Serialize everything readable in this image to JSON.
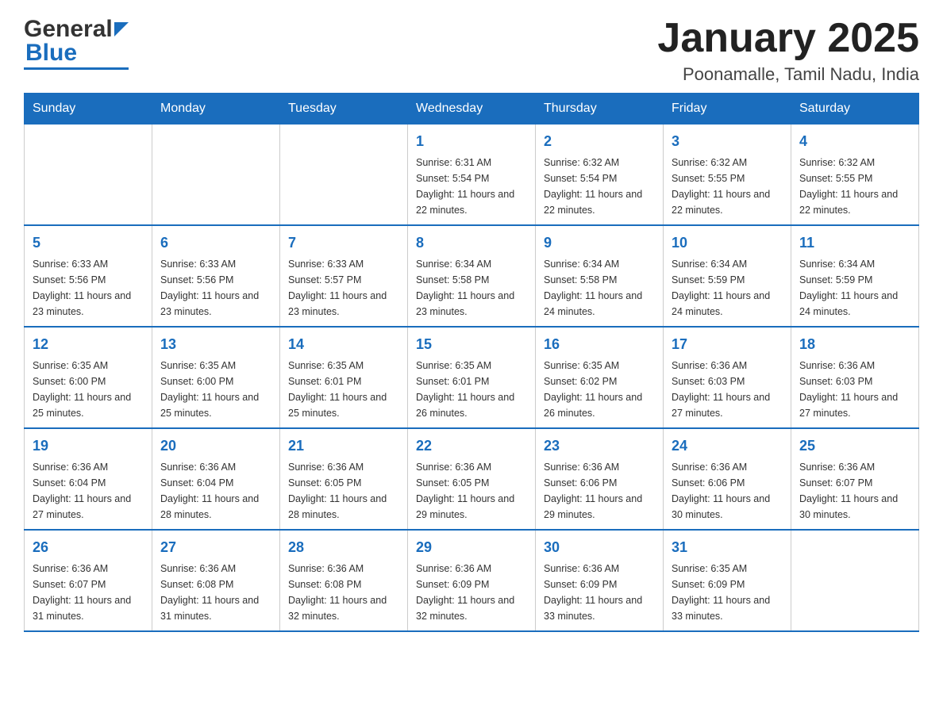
{
  "header": {
    "logo_general": "General",
    "logo_blue": "Blue",
    "title": "January 2025",
    "location": "Poonamalle, Tamil Nadu, India"
  },
  "days_of_week": [
    "Sunday",
    "Monday",
    "Tuesday",
    "Wednesday",
    "Thursday",
    "Friday",
    "Saturday"
  ],
  "weeks": [
    [
      {
        "day": "",
        "info": ""
      },
      {
        "day": "",
        "info": ""
      },
      {
        "day": "",
        "info": ""
      },
      {
        "day": "1",
        "info": "Sunrise: 6:31 AM\nSunset: 5:54 PM\nDaylight: 11 hours\nand 22 minutes."
      },
      {
        "day": "2",
        "info": "Sunrise: 6:32 AM\nSunset: 5:54 PM\nDaylight: 11 hours\nand 22 minutes."
      },
      {
        "day": "3",
        "info": "Sunrise: 6:32 AM\nSunset: 5:55 PM\nDaylight: 11 hours\nand 22 minutes."
      },
      {
        "day": "4",
        "info": "Sunrise: 6:32 AM\nSunset: 5:55 PM\nDaylight: 11 hours\nand 22 minutes."
      }
    ],
    [
      {
        "day": "5",
        "info": "Sunrise: 6:33 AM\nSunset: 5:56 PM\nDaylight: 11 hours\nand 23 minutes."
      },
      {
        "day": "6",
        "info": "Sunrise: 6:33 AM\nSunset: 5:56 PM\nDaylight: 11 hours\nand 23 minutes."
      },
      {
        "day": "7",
        "info": "Sunrise: 6:33 AM\nSunset: 5:57 PM\nDaylight: 11 hours\nand 23 minutes."
      },
      {
        "day": "8",
        "info": "Sunrise: 6:34 AM\nSunset: 5:58 PM\nDaylight: 11 hours\nand 23 minutes."
      },
      {
        "day": "9",
        "info": "Sunrise: 6:34 AM\nSunset: 5:58 PM\nDaylight: 11 hours\nand 24 minutes."
      },
      {
        "day": "10",
        "info": "Sunrise: 6:34 AM\nSunset: 5:59 PM\nDaylight: 11 hours\nand 24 minutes."
      },
      {
        "day": "11",
        "info": "Sunrise: 6:34 AM\nSunset: 5:59 PM\nDaylight: 11 hours\nand 24 minutes."
      }
    ],
    [
      {
        "day": "12",
        "info": "Sunrise: 6:35 AM\nSunset: 6:00 PM\nDaylight: 11 hours\nand 25 minutes."
      },
      {
        "day": "13",
        "info": "Sunrise: 6:35 AM\nSunset: 6:00 PM\nDaylight: 11 hours\nand 25 minutes."
      },
      {
        "day": "14",
        "info": "Sunrise: 6:35 AM\nSunset: 6:01 PM\nDaylight: 11 hours\nand 25 minutes."
      },
      {
        "day": "15",
        "info": "Sunrise: 6:35 AM\nSunset: 6:01 PM\nDaylight: 11 hours\nand 26 minutes."
      },
      {
        "day": "16",
        "info": "Sunrise: 6:35 AM\nSunset: 6:02 PM\nDaylight: 11 hours\nand 26 minutes."
      },
      {
        "day": "17",
        "info": "Sunrise: 6:36 AM\nSunset: 6:03 PM\nDaylight: 11 hours\nand 27 minutes."
      },
      {
        "day": "18",
        "info": "Sunrise: 6:36 AM\nSunset: 6:03 PM\nDaylight: 11 hours\nand 27 minutes."
      }
    ],
    [
      {
        "day": "19",
        "info": "Sunrise: 6:36 AM\nSunset: 6:04 PM\nDaylight: 11 hours\nand 27 minutes."
      },
      {
        "day": "20",
        "info": "Sunrise: 6:36 AM\nSunset: 6:04 PM\nDaylight: 11 hours\nand 28 minutes."
      },
      {
        "day": "21",
        "info": "Sunrise: 6:36 AM\nSunset: 6:05 PM\nDaylight: 11 hours\nand 28 minutes."
      },
      {
        "day": "22",
        "info": "Sunrise: 6:36 AM\nSunset: 6:05 PM\nDaylight: 11 hours\nand 29 minutes."
      },
      {
        "day": "23",
        "info": "Sunrise: 6:36 AM\nSunset: 6:06 PM\nDaylight: 11 hours\nand 29 minutes."
      },
      {
        "day": "24",
        "info": "Sunrise: 6:36 AM\nSunset: 6:06 PM\nDaylight: 11 hours\nand 30 minutes."
      },
      {
        "day": "25",
        "info": "Sunrise: 6:36 AM\nSunset: 6:07 PM\nDaylight: 11 hours\nand 30 minutes."
      }
    ],
    [
      {
        "day": "26",
        "info": "Sunrise: 6:36 AM\nSunset: 6:07 PM\nDaylight: 11 hours\nand 31 minutes."
      },
      {
        "day": "27",
        "info": "Sunrise: 6:36 AM\nSunset: 6:08 PM\nDaylight: 11 hours\nand 31 minutes."
      },
      {
        "day": "28",
        "info": "Sunrise: 6:36 AM\nSunset: 6:08 PM\nDaylight: 11 hours\nand 32 minutes."
      },
      {
        "day": "29",
        "info": "Sunrise: 6:36 AM\nSunset: 6:09 PM\nDaylight: 11 hours\nand 32 minutes."
      },
      {
        "day": "30",
        "info": "Sunrise: 6:36 AM\nSunset: 6:09 PM\nDaylight: 11 hours\nand 33 minutes."
      },
      {
        "day": "31",
        "info": "Sunrise: 6:35 AM\nSunset: 6:09 PM\nDaylight: 11 hours\nand 33 minutes."
      },
      {
        "day": "",
        "info": ""
      }
    ]
  ]
}
